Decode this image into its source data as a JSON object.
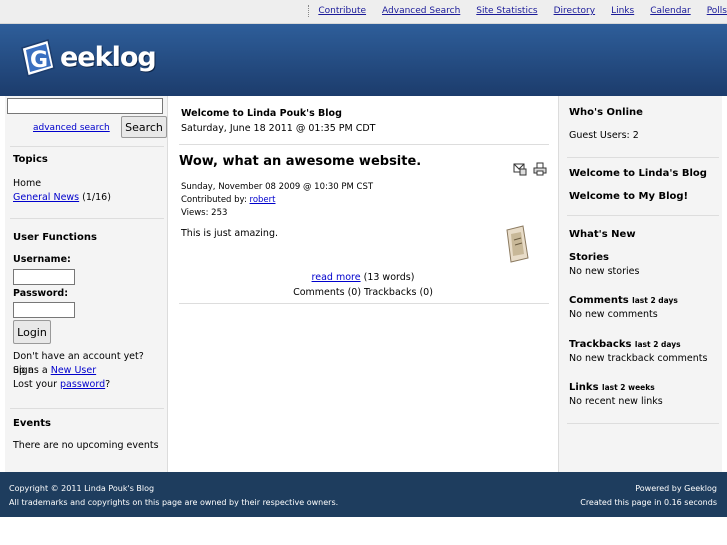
{
  "topnav": [
    "Contribute",
    "Advanced Search",
    "Site Statistics",
    "Directory",
    "Links",
    "Calendar",
    "Polls"
  ],
  "logo": {
    "text": "eeklog",
    "letter": "G"
  },
  "left": {
    "search_button": "Search",
    "advanced_search": "advanced search",
    "topics_title": "Topics",
    "topic_home": "Home",
    "topic_general_news": "General News",
    "topic_general_news_count": "(1/16)",
    "user_functions_title": "User Functions",
    "username_label": "Username:",
    "password_label": "Password:",
    "login_button": "Login",
    "signup_prefix": "Don't have an account yet? Sign",
    "signup_middle": "up as a",
    "new_user_link": "New User",
    "lost_prefix": "Lost your",
    "password_link": "password",
    "lost_suffix": "?",
    "events_title": "Events",
    "events_text": "There are no upcoming events"
  },
  "center": {
    "welcome_title": "Welcome to Linda Pouk's Blog",
    "welcome_date": "Saturday, June 18 2011 @ 01:35 PM CDT",
    "story_title": "Wow, what an awesome website.",
    "story_date": "Sunday, November 08 2009 @ 10:30 PM CST",
    "contributed_label": "Contributed by:",
    "contributor": "robert",
    "views": "Views: 253",
    "body": "This is just amazing.",
    "read_more": "read more",
    "word_count": "(13 words)",
    "comments": "Comments (0) Trackbacks (0)"
  },
  "right": {
    "whos_online_title": "Who's Online",
    "guest_users": "Guest Users: 2",
    "welcome_linda": "Welcome to Linda's Blog",
    "welcome_my_blog": "Welcome to My Blog!",
    "whats_new_title": "What's New",
    "stories_title": "Stories",
    "stories_text": "No new stories",
    "comments_title": "Comments",
    "comments_period": "last 2 days",
    "comments_text": "No new comments",
    "trackbacks_title": "Trackbacks",
    "trackbacks_period": "last 2 days",
    "trackbacks_text": "No new trackback comments",
    "links_title": "Links",
    "links_period": "last 2 weeks",
    "links_text": "No recent new links"
  },
  "footer": {
    "copyright": "Copyright © 2011 Linda Pouk's Blog",
    "trademarks": "All trademarks and copyrights on this page are owned by their respective owners.",
    "powered": "Powered by Geeklog",
    "created": "Created this page in 0.16 seconds"
  },
  "colors": {
    "header": "#1c3c6c",
    "footer": "#1e3d5e",
    "link": "#0000cc"
  }
}
